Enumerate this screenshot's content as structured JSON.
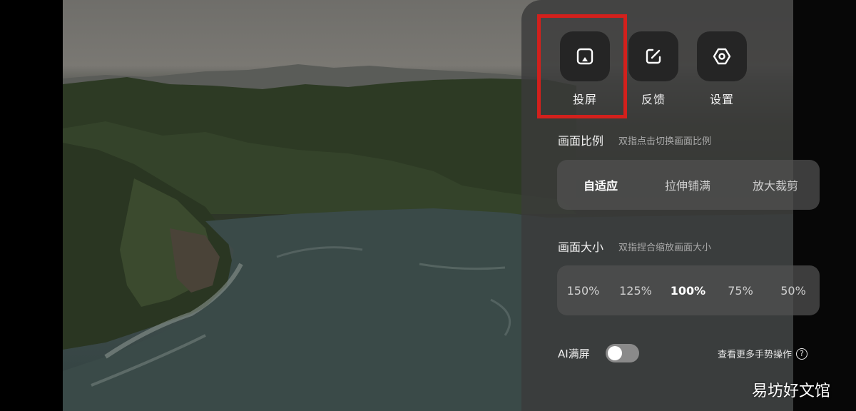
{
  "actions": [
    {
      "label": "投屏",
      "icon": "cast-icon"
    },
    {
      "label": "反馈",
      "icon": "edit-icon"
    },
    {
      "label": "设置",
      "icon": "hexagon-settings-icon"
    }
  ],
  "aspect_ratio": {
    "title": "画面比例",
    "hint": "双指点击切换画面比例",
    "options": [
      "自适应",
      "拉伸铺满",
      "放大裁剪"
    ],
    "selected": "自适应"
  },
  "picture_size": {
    "title": "画面大小",
    "hint": "双指捏合缩放画面大小",
    "options": [
      "150%",
      "125%",
      "100%",
      "75%",
      "50%"
    ],
    "selected": "100%"
  },
  "ai_fullscreen": {
    "label": "AI满屏",
    "enabled": false
  },
  "more_gestures": {
    "label": "查看更多手势操作",
    "icon": "question-circle-icon"
  },
  "watermark": "易坊好文馆",
  "colors": {
    "highlight": "#d3201c",
    "panel": "#3a3a3a"
  }
}
